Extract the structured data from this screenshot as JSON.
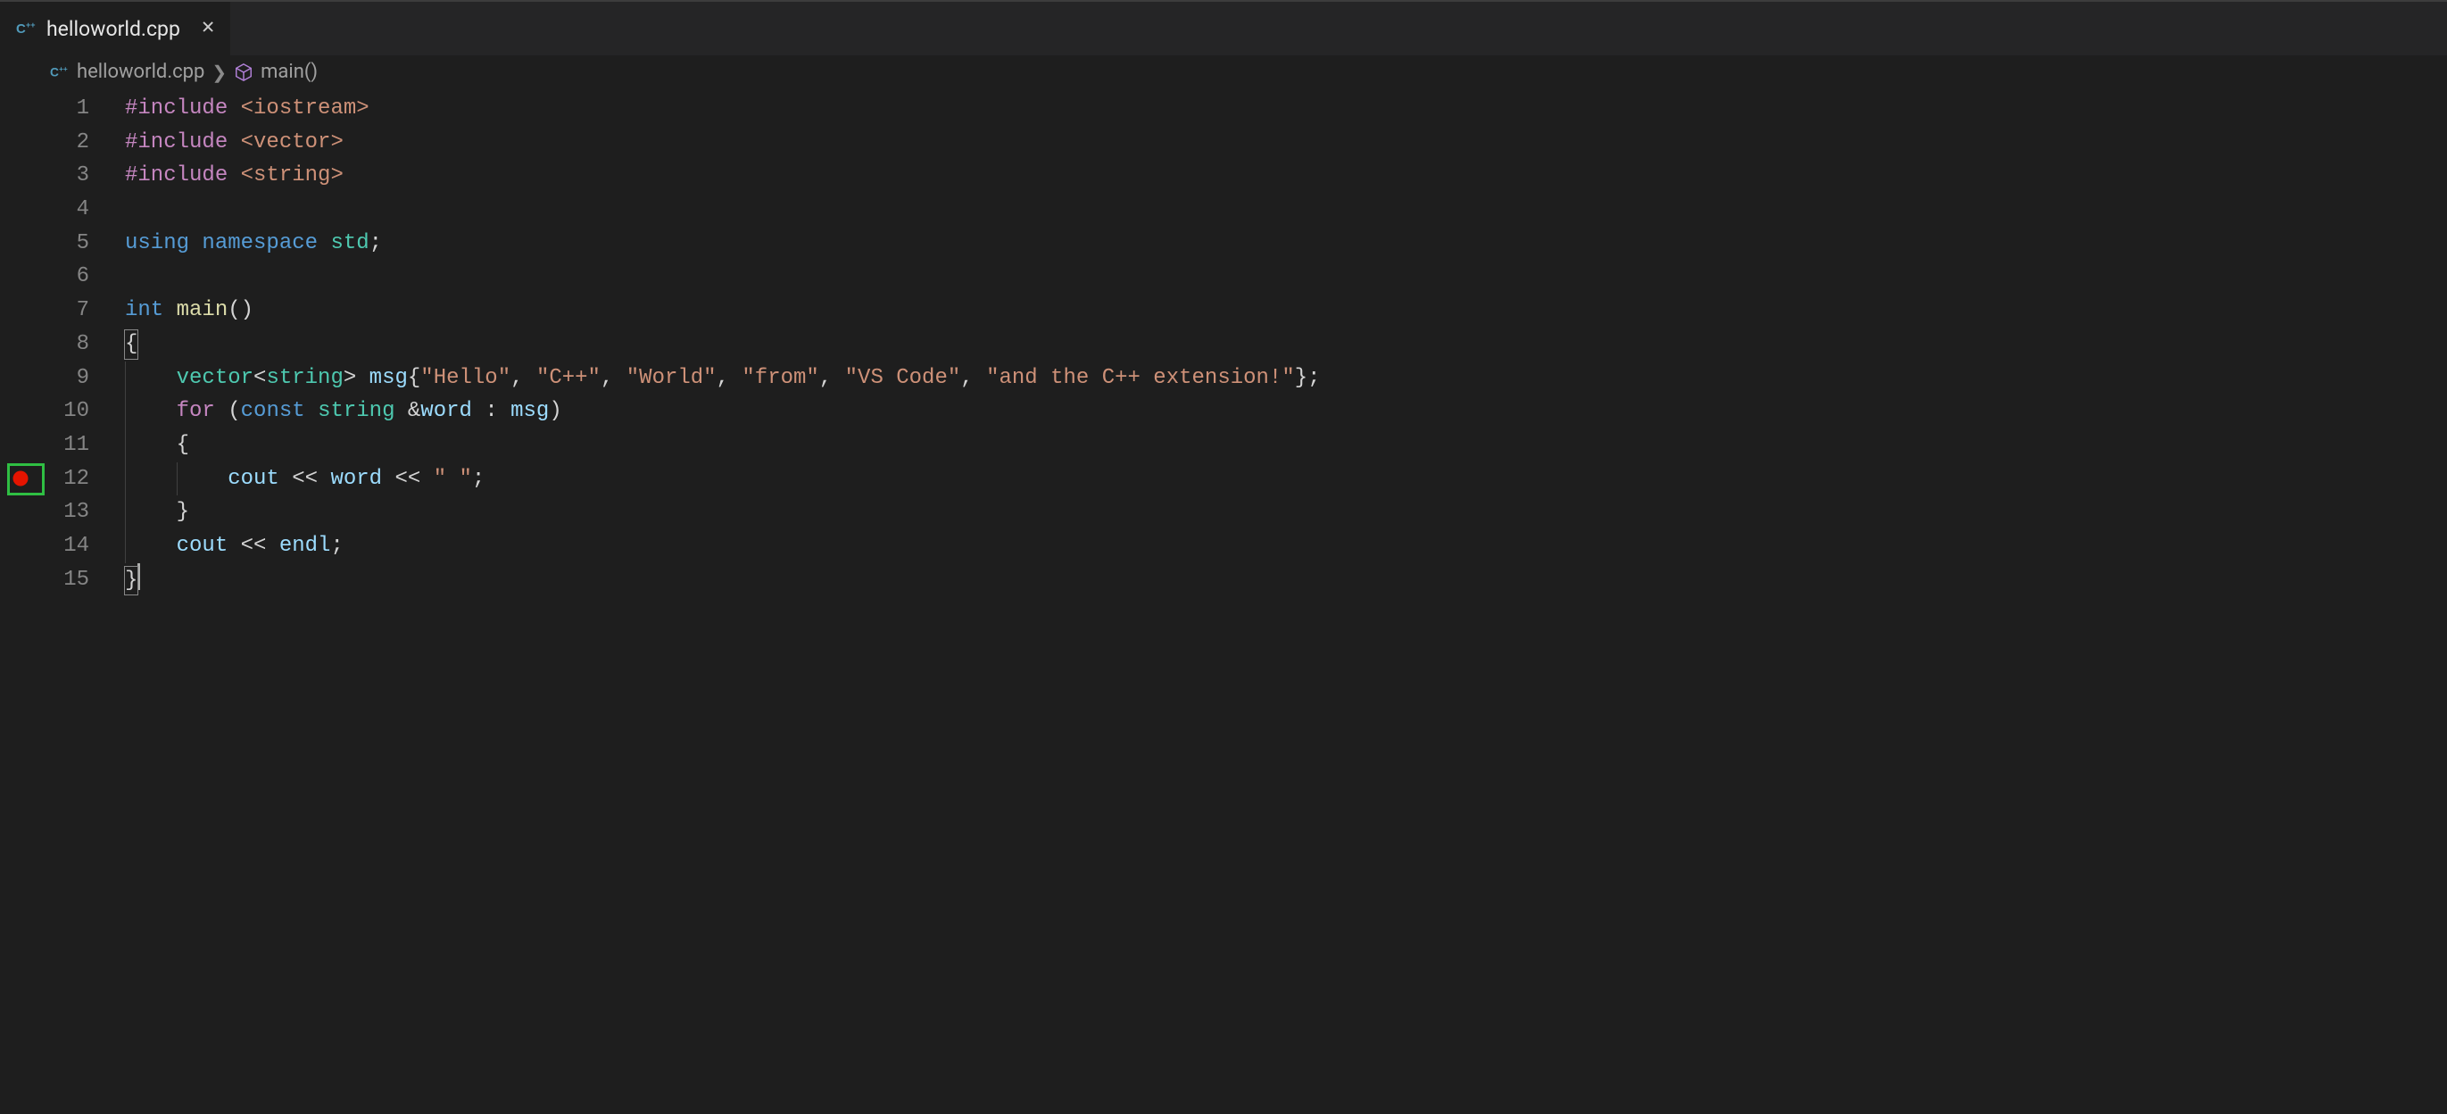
{
  "tab": {
    "label": "helloworld.cpp"
  },
  "breadcrumb": {
    "file": "helloworld.cpp",
    "symbol": "main()"
  },
  "lines": [
    {
      "n": "1"
    },
    {
      "n": "2"
    },
    {
      "n": "3"
    },
    {
      "n": "4"
    },
    {
      "n": "5"
    },
    {
      "n": "6"
    },
    {
      "n": "7"
    },
    {
      "n": "8"
    },
    {
      "n": "9"
    },
    {
      "n": "10"
    },
    {
      "n": "11"
    },
    {
      "n": "12"
    },
    {
      "n": "13"
    },
    {
      "n": "14"
    },
    {
      "n": "15"
    }
  ],
  "code": {
    "l1": {
      "directive": "#include",
      "inc": "<iostream>"
    },
    "l2": {
      "directive": "#include",
      "inc": "<vector>"
    },
    "l3": {
      "directive": "#include",
      "inc": "<string>"
    },
    "l5": {
      "using": "using",
      "namespace_kw": "namespace",
      "ns": "std"
    },
    "l7": {
      "int": "int",
      "main": "main"
    },
    "l8": {
      "brace": "{"
    },
    "l9": {
      "vector": "vector",
      "string": "string",
      "msg": "msg",
      "s1": "\"Hello\"",
      "s2": "\"C++\"",
      "s3": "\"World\"",
      "s4": "\"from\"",
      "s5": "\"VS Code\"",
      "s6": "\"and the C++ extension!\""
    },
    "l10": {
      "for": "for",
      "const": "const",
      "string": "string",
      "word": "word",
      "msg": "msg"
    },
    "l11": {
      "brace": "{"
    },
    "l12": {
      "cout": "cout",
      "word": "word",
      "space": "\" \""
    },
    "l13": {
      "brace": "}"
    },
    "l14": {
      "cout": "cout",
      "endl": "endl"
    },
    "l15": {
      "brace": "}"
    }
  },
  "breakpoint_line": 12
}
